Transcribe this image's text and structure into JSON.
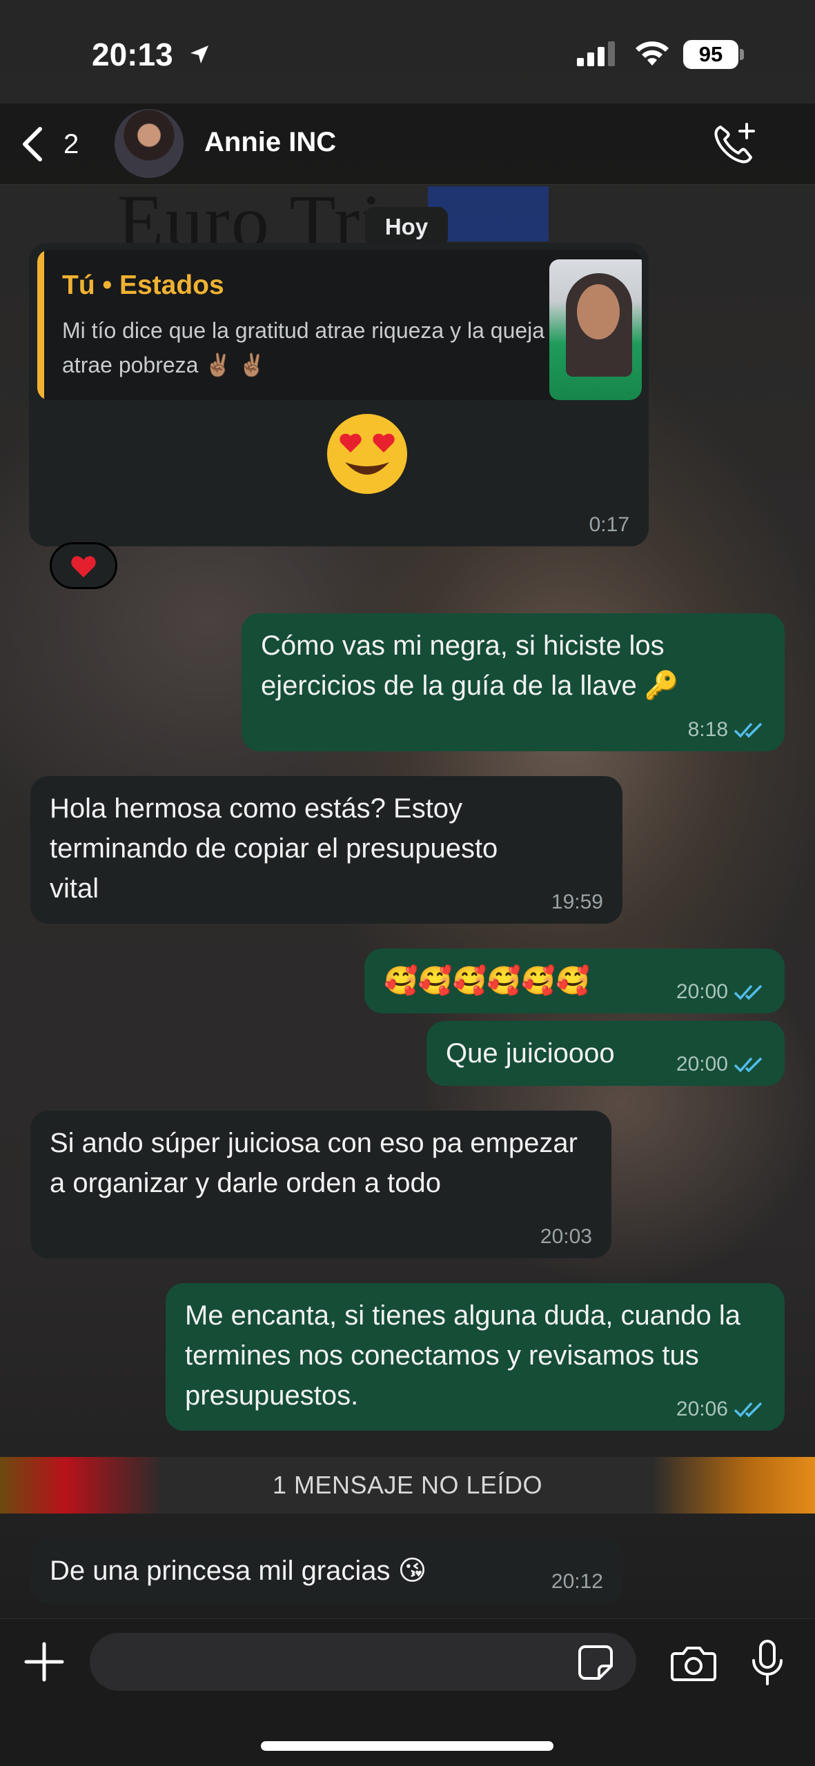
{
  "status_bar": {
    "time": "20:13",
    "battery": "95"
  },
  "header": {
    "back_count": "2",
    "contact_name": "Annie INC"
  },
  "day_label": "Hoy",
  "status_reply": {
    "quote_title": "Tú • Estados",
    "quote_text": "Mi tío dice que la gratitud atrae riqueza y la queja atrae pobreza ✌🏽 ✌🏽",
    "emoji": "😍",
    "time": "0:17",
    "reaction": "❤️"
  },
  "messages": [
    {
      "direction": "out",
      "text": "Cómo vas mi negra, si hiciste los ejercicios de la guía de la llave 🔑",
      "time": "8:18",
      "read": true
    },
    {
      "direction": "in",
      "text": "Hola hermosa como estás? Estoy terminando de copiar el presupuesto vital",
      "time": "19:59"
    },
    {
      "direction": "out",
      "text": "🥰🥰🥰🥰🥰🥰",
      "time": "20:00",
      "read": true
    },
    {
      "direction": "out",
      "text": "Que juicioooo",
      "time": "20:00",
      "read": true
    },
    {
      "direction": "in",
      "text": "Si ando súper juiciosa con eso pa empezar a organizar y darle orden a todo",
      "time": "20:03"
    },
    {
      "direction": "out",
      "text": "Me encanta, si tienes alguna duda, cuando la termines nos conectamos y revisamos tus presupuestos.",
      "time": "20:06",
      "read": true
    },
    {
      "direction": "in",
      "text": "De una princesa mil gracias 😘",
      "time": "20:12"
    }
  ],
  "unread_banner": "1 MENSAJE NO LEÍDO",
  "composer": {
    "placeholder": ""
  },
  "colors": {
    "incoming_bubble": "#1f2223",
    "outgoing_bubble": "#154d37",
    "quote_accent": "#f0b232",
    "read_ticks": "#53bdeb"
  },
  "icons": [
    "location-arrow-icon",
    "signal-icon",
    "wifi-icon",
    "battery-icon",
    "chevron-left-icon",
    "add-call-icon",
    "plus-icon",
    "sticker-icon",
    "camera-icon",
    "microphone-icon"
  ]
}
